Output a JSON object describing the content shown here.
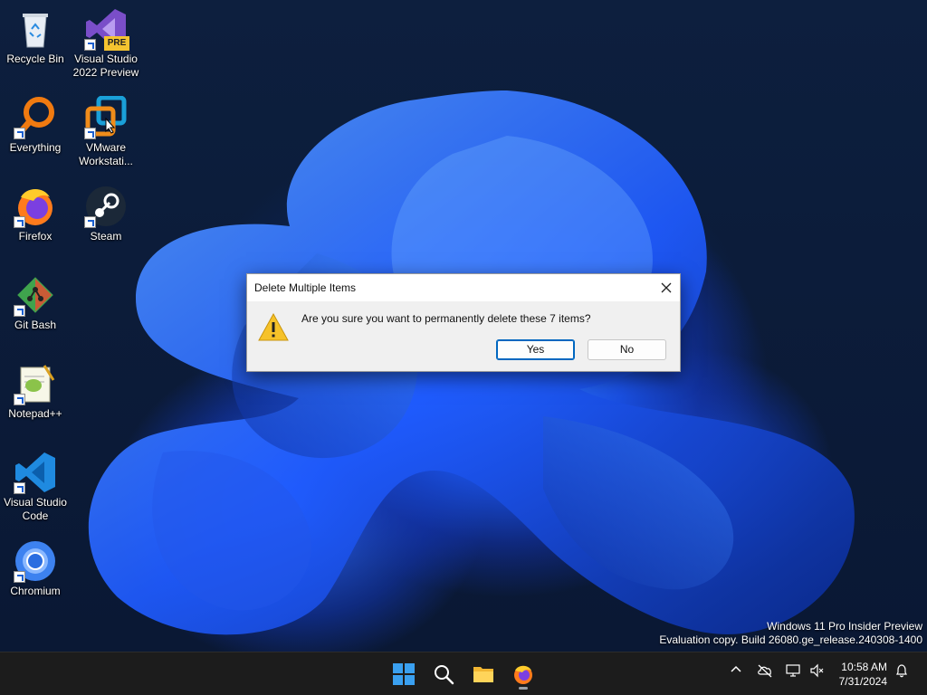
{
  "desktop": {
    "icons": [
      {
        "label": "Recycle Bin",
        "icon": "recycle-bin-icon"
      },
      {
        "label": "Visual Studio 2022 Preview",
        "icon": "visual-studio-icon",
        "badge": "PRE"
      },
      {
        "label": "Everything",
        "icon": "everything-search-icon"
      },
      {
        "label": "VMware Workstati...",
        "icon": "vmware-icon"
      },
      {
        "label": "Firefox",
        "icon": "firefox-icon"
      },
      {
        "label": "Steam",
        "icon": "steam-icon"
      },
      {
        "label": "Git Bash",
        "icon": "git-bash-icon"
      },
      {
        "label": "Notepad++",
        "icon": "notepad-plus-plus-icon"
      },
      {
        "label": "Visual Studio Code",
        "icon": "vscode-icon"
      },
      {
        "label": "Chromium",
        "icon": "chromium-icon"
      }
    ]
  },
  "dialog": {
    "title": "Delete Multiple Items",
    "message": "Are you sure you want to permanently delete these 7 items?",
    "yes_label": "Yes",
    "no_label": "No"
  },
  "watermark": {
    "line1": "Windows 11 Pro Insider Preview",
    "line2": "Evaluation copy. Build 26080.ge_release.240308-1400"
  },
  "taskbar": {
    "apps": [
      "start-icon",
      "search-icon",
      "file-explorer-icon",
      "firefox-icon"
    ],
    "time": "10:58 AM",
    "date": "7/31/2024"
  },
  "colors": {
    "accent": "#0067c0",
    "taskbar": "#1c1c1c",
    "dialog_bg": "#f0f0f0",
    "warning": "#f6c229"
  }
}
